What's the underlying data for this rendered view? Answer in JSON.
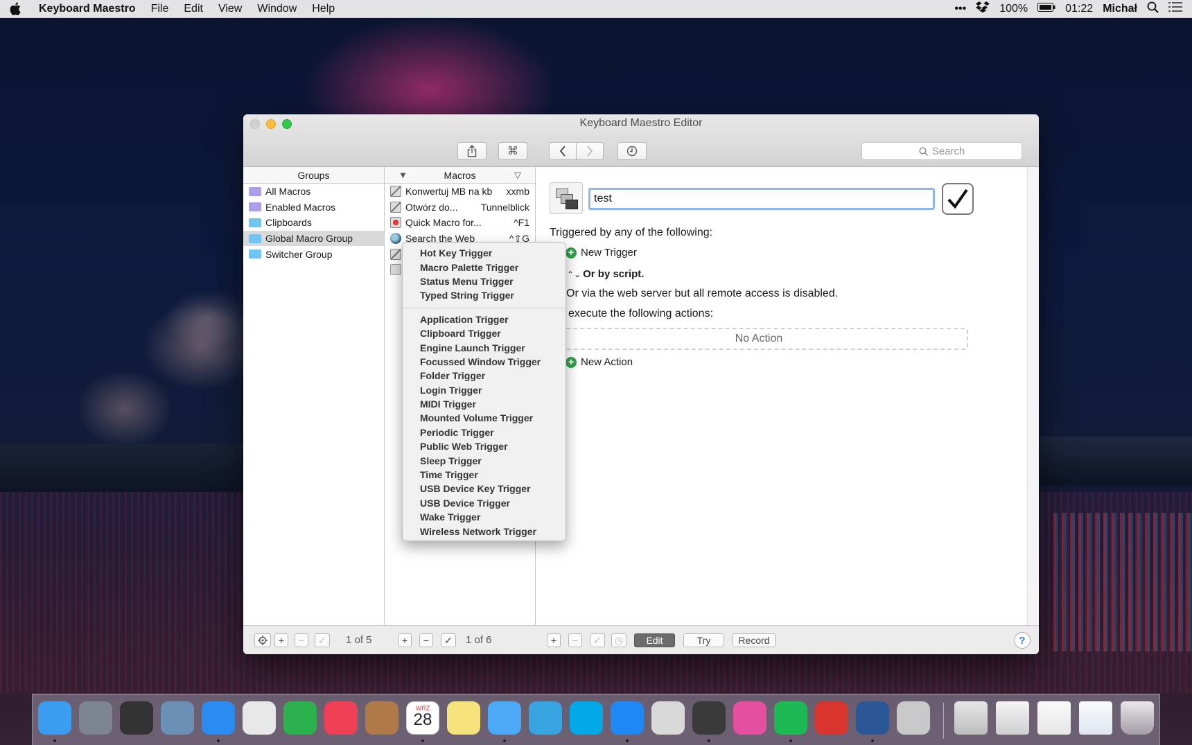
{
  "menubar": {
    "app_name": "Keyboard Maestro",
    "items": [
      "File",
      "Edit",
      "View",
      "Window",
      "Help"
    ],
    "status": {
      "more": "•••",
      "battery": "100%",
      "time": "01:22",
      "user": "Michał"
    }
  },
  "window": {
    "title": "Keyboard Maestro Editor",
    "search_placeholder": "Search"
  },
  "groups": {
    "header": "Groups",
    "items": [
      {
        "label": "All Macros",
        "type": "smart"
      },
      {
        "label": "Enabled Macros",
        "type": "smart"
      },
      {
        "label": "Clipboards",
        "type": "folder"
      },
      {
        "label": "Global Macro Group",
        "type": "folder",
        "selected": true
      },
      {
        "label": "Switcher Group",
        "type": "folder"
      }
    ],
    "count": "1 of 5"
  },
  "macros": {
    "header": "Macros",
    "items": [
      {
        "name": "Konwertuj MB na kb",
        "key": "xxmb",
        "icon": "stack"
      },
      {
        "name": "Otwórz do...",
        "key": "Tunnelblick",
        "icon": "stack"
      },
      {
        "name": "Quick Macro for...",
        "key": "^F1",
        "icon": "record"
      },
      {
        "name": "Search the Web",
        "key": "^⇧G",
        "icon": "globe"
      },
      {
        "name": "",
        "key": "",
        "icon": "stack"
      },
      {
        "name": "",
        "key": "",
        "icon": "blank"
      }
    ],
    "count": "1 of 6"
  },
  "editor": {
    "macro_name": "test",
    "triggered_by": "Triggered by any of the following:",
    "new_trigger": "New Trigger",
    "or_by_script": "Or by script.",
    "web_server": "Or via the web server but all remote access is disabled.",
    "execute": "l execute the following actions:",
    "no_action": "No Action",
    "new_action": "New Action"
  },
  "bottombar": {
    "edit": "Edit",
    "try": "Try",
    "record": "Record",
    "help": "?"
  },
  "trigger_menu": {
    "group1": [
      "Hot Key Trigger",
      "Macro Palette Trigger",
      "Status Menu Trigger",
      "Typed String Trigger"
    ],
    "group2": [
      "Application Trigger",
      "Clipboard Trigger",
      "Engine Launch Trigger",
      "Focussed Window Trigger",
      "Folder Trigger",
      "Login Trigger",
      "MIDI Trigger",
      "Mounted Volume Trigger",
      "Periodic Trigger",
      "Public Web Trigger",
      "Sleep Trigger",
      "Time Trigger",
      "USB Device Key Trigger",
      "USB Device Trigger",
      "Wake Trigger",
      "Wireless Network Trigger"
    ]
  },
  "dock": {
    "calendar_month": "WRZ",
    "calendar_day": "28",
    "apps": [
      {
        "name": "finder-icon",
        "color": "#3a9df2"
      },
      {
        "name": "launchpad-icon",
        "color": "#7d8592"
      },
      {
        "name": "photo-booth-icon",
        "color": "#333333"
      },
      {
        "name": "preview-icon",
        "color": "#6b8fb5"
      },
      {
        "name": "safari-icon",
        "color": "#2a8cf2"
      },
      {
        "name": "chrome-icon",
        "color": "#e8e8e8"
      },
      {
        "name": "feedly-icon",
        "color": "#2bb24c"
      },
      {
        "name": "pocket-icon",
        "color": "#ef4056"
      },
      {
        "name": "contacts-icon",
        "color": "#b07a48"
      },
      {
        "name": "calendar-icon",
        "color": "#ffffff"
      },
      {
        "name": "notes-icon",
        "color": "#f4e27a"
      },
      {
        "name": "messages-icon",
        "color": "#4ba9f7"
      },
      {
        "name": "telegram-icon",
        "color": "#37a3e0"
      },
      {
        "name": "skype-icon",
        "color": "#00a8e8"
      },
      {
        "name": "messenger-icon",
        "color": "#1e88f5"
      },
      {
        "name": "preview-app-icon",
        "color": "#d9d9d9"
      },
      {
        "name": "evernote-icon",
        "color": "#3a3a3a"
      },
      {
        "name": "itunes-icon",
        "color": "#e54fa0"
      },
      {
        "name": "spotify-icon",
        "color": "#1db954"
      },
      {
        "name": "transmission-icon",
        "color": "#d8342e"
      },
      {
        "name": "word-icon",
        "color": "#2b5797"
      },
      {
        "name": "keyboard-maestro-icon",
        "color": "#c8c8c8"
      }
    ]
  }
}
